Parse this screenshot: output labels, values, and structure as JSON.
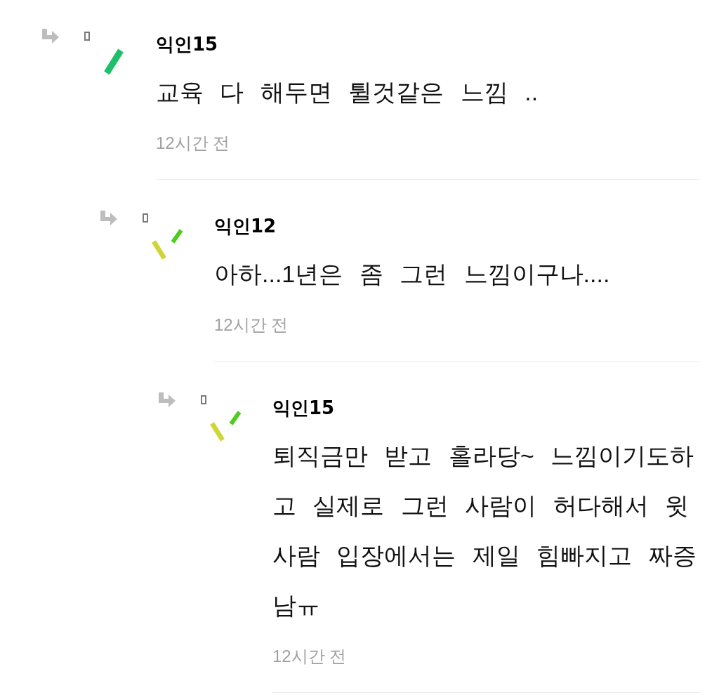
{
  "comments": [
    {
      "author": "익인15",
      "text": "교육 다 해두면 튈것같은 느낌 ..",
      "time": "12시간 전",
      "kind": "single",
      "children": [
        {
          "author": "익인12",
          "text": "아하...1년은 좀 그런 느낌이구나....",
          "time": "12시간 전",
          "kind": "double",
          "children": [
            {
              "author": "익인15",
              "text": "퇴직금만 받고 홀라당~ 느낌이기도하고 실제로 그런 사람이 허다해서 윗 사람 입장에서는 제일 힘빠지고 짜증남ㅠ",
              "time": "12시간 전",
              "kind": "double"
            }
          ]
        }
      ]
    }
  ]
}
